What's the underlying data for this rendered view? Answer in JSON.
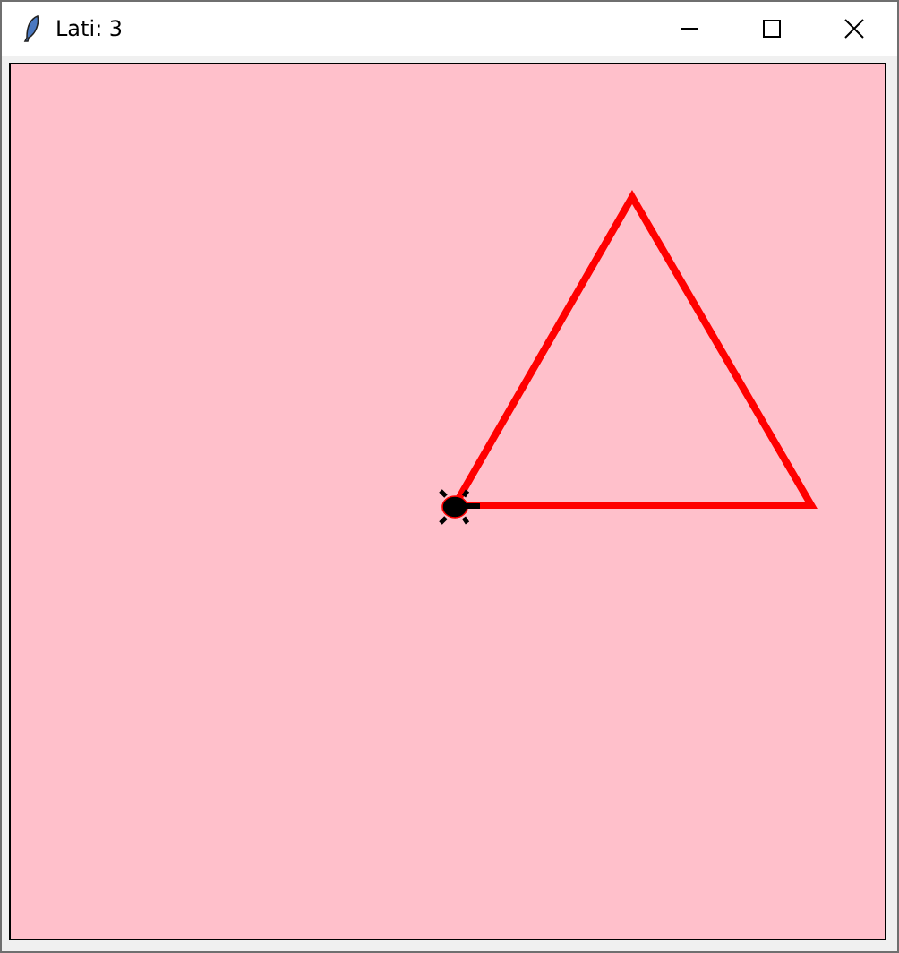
{
  "window": {
    "title": "Lati: 3"
  }
}
